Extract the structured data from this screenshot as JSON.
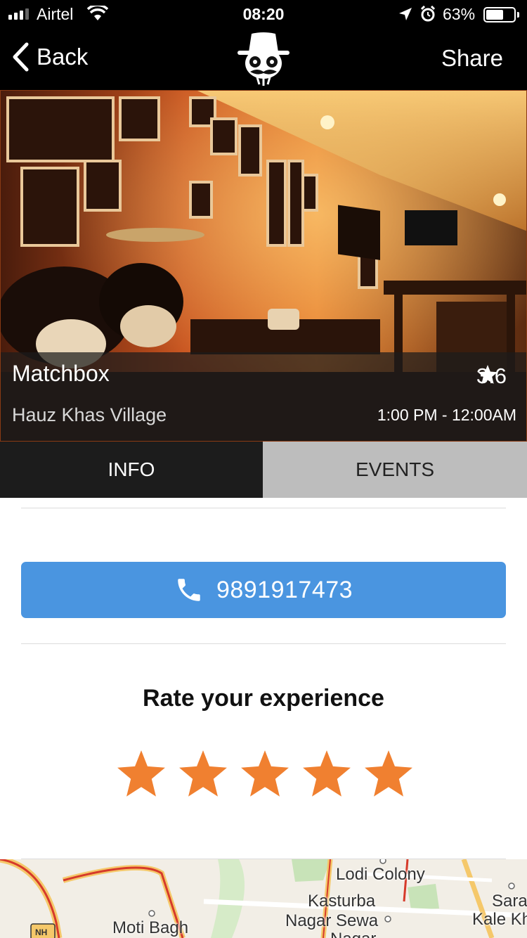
{
  "status_bar": {
    "carrier": "Airtel",
    "time": "08:20",
    "battery_percent": "63%",
    "battery_level": 0.63,
    "icons": [
      "signal-icon",
      "wifi-icon",
      "location-arrow-icon",
      "alarm-icon",
      "battery-icon"
    ]
  },
  "nav": {
    "back_label": "Back",
    "share_label": "Share",
    "logo_icon": "mustache-face-logo"
  },
  "venue": {
    "name": "Matchbox",
    "area": "Hauz Khas Village",
    "rating": "3.6",
    "hours": "1:00 PM - 12:00AM"
  },
  "tabs": [
    {
      "label": "INFO",
      "active": true
    },
    {
      "label": "EVENTS",
      "active": false
    }
  ],
  "contact": {
    "phone": "9891917473",
    "icon": "phone-icon"
  },
  "rating_prompt": {
    "title": "Rate your experience",
    "star_count": 5,
    "star_color": "#F08030"
  },
  "map": {
    "labels": [
      "Lodi Colony",
      "Kasturba",
      "Nagar Sewa",
      "Nagar",
      "Moti Bagh",
      "Sara",
      "Kale Kh",
      "NH"
    ]
  },
  "colors": {
    "call_button": "#4A95E0",
    "tab_active_bg": "#1C1C1C",
    "tab_inactive_bg": "#BDBDBD",
    "star": "#F08030"
  }
}
